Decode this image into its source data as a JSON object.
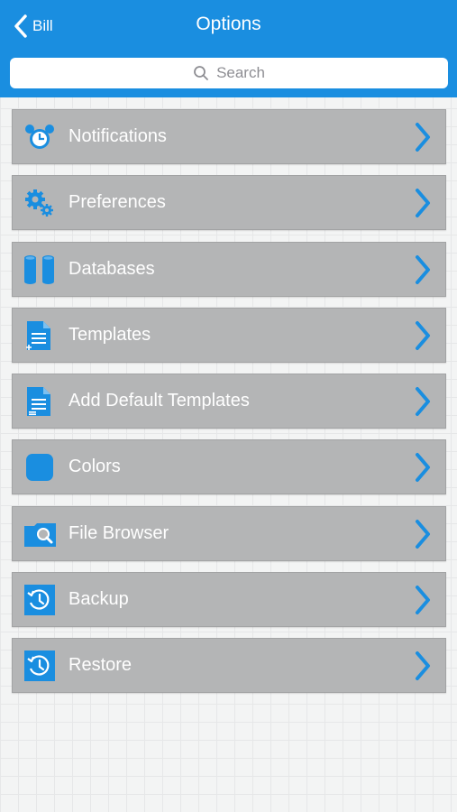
{
  "nav": {
    "back_label": "Bill",
    "title": "Options"
  },
  "search": {
    "placeholder": "Search"
  },
  "colors": {
    "header": "#1a8ee0",
    "accent": "#1a8ee0",
    "row_bg": "#b4b5b6"
  },
  "menu": [
    {
      "label": "Notifications",
      "icon": "alarm-clock-icon"
    },
    {
      "label": "Preferences",
      "icon": "gears-icon"
    },
    {
      "label": "Databases",
      "icon": "database-icon"
    },
    {
      "label": "Templates",
      "icon": "template-document-icon"
    },
    {
      "label": "Add Default Templates",
      "icon": "add-templates-document-icon"
    },
    {
      "label": "Colors",
      "icon": "color-swatch-icon"
    },
    {
      "label": "File Browser",
      "icon": "folder-search-icon"
    },
    {
      "label": "Backup",
      "icon": "backup-clock-icon"
    },
    {
      "label": "Restore",
      "icon": "restore-clock-icon"
    }
  ]
}
